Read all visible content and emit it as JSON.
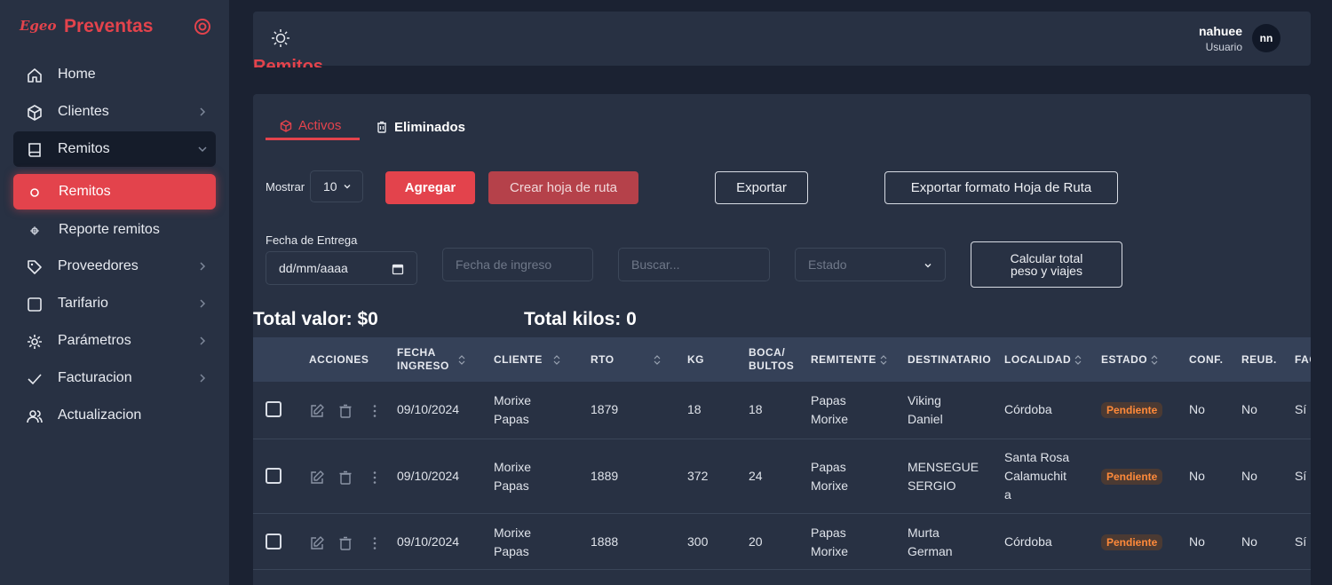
{
  "sidebar": {
    "logo": "Egeo",
    "title": "Preventas",
    "items": [
      {
        "label": "Home",
        "icon": "home-icon"
      },
      {
        "label": "Clientes",
        "icon": "box-icon"
      },
      {
        "label": "Remitos",
        "icon": "book-icon"
      },
      {
        "label": "Remitos",
        "icon": "circle-icon"
      },
      {
        "label": "Reporte remitos",
        "icon": "dot-icon"
      },
      {
        "label": "Proveedores",
        "icon": "tag-icon"
      },
      {
        "label": "Tarifario",
        "icon": "square-icon"
      },
      {
        "label": "Parámetros",
        "icon": "gear-icon"
      },
      {
        "label": "Facturacion",
        "icon": "check-icon"
      },
      {
        "label": "Actualizacion",
        "icon": "users-icon"
      }
    ]
  },
  "header": {
    "user_name": "nahuee",
    "user_role": "Usuario",
    "avatar_initials": "nn"
  },
  "page": {
    "title": "Remitos"
  },
  "tabs": [
    {
      "label": "Activos",
      "active": true
    },
    {
      "label": "Eliminados",
      "active": false
    }
  ],
  "toolbar": {
    "mostrar_label": "Mostrar",
    "page_size": "10",
    "agregar": "Agregar",
    "crear_hoja": "Crear hoja de ruta",
    "exportar": "Exportar",
    "exportar_formato": "Exportar formato Hoja de Ruta"
  },
  "filters": {
    "fecha_entrega_label": "Fecha de Entrega",
    "fecha_entrega_value": "dd/mm/aaaa",
    "fecha_ingreso_placeholder": "Fecha de ingreso",
    "buscar_placeholder": "Buscar...",
    "estado_placeholder": "Estado",
    "calcular_line1": "Calcular total",
    "calcular_line2": "peso y viajes"
  },
  "totals": {
    "valor": "Total valor: $0",
    "kilos": "Total kilos: 0"
  },
  "table": {
    "headers": {
      "acciones": "ACCIONES",
      "fecha1": "FECHA",
      "fecha2": "INGRESO",
      "cliente": "CLIENTE",
      "rto": "RTO",
      "kg": "KG",
      "boca1": "BOCA/",
      "boca2": "BULTOS",
      "remitente": "REMITENTE",
      "destinatario": "DESTINATARIO",
      "localidad": "LOCALIDAD",
      "estado": "ESTADO",
      "conf": "CONF.",
      "reub": "REUB.",
      "fac": "FACTURA"
    },
    "rows": [
      {
        "fecha": "09/10/2024",
        "cliente1": "Morixe",
        "cliente2": "Papas",
        "rto": "1879",
        "kg": "18",
        "bultos": "18",
        "rem1": "Papas",
        "rem2": "Morixe",
        "dest1": "Viking",
        "dest2": "Daniel",
        "loc1": "Córdoba",
        "loc2": "",
        "loc3": "",
        "estado": "Pendiente",
        "conf": "No",
        "reub": "No",
        "fac": "Sí"
      },
      {
        "fecha": "09/10/2024",
        "cliente1": "Morixe",
        "cliente2": "Papas",
        "rto": "1889",
        "kg": "372",
        "bultos": "24",
        "rem1": "Papas",
        "rem2": "Morixe",
        "dest1": "MENSEGUE",
        "dest2": "SERGIO",
        "loc1": "Santa Rosa",
        "loc2": "Calamuchit",
        "loc3": "a",
        "estado": "Pendiente",
        "conf": "No",
        "reub": "No",
        "fac": "Sí"
      },
      {
        "fecha": "09/10/2024",
        "cliente1": "Morixe",
        "cliente2": "Papas",
        "rto": "1888",
        "kg": "300",
        "bultos": "20",
        "rem1": "Papas",
        "rem2": "Morixe",
        "dest1": "Murta",
        "dest2": "German",
        "loc1": "Córdoba",
        "loc2": "",
        "loc3": "",
        "estado": "Pendiente",
        "conf": "No",
        "reub": "No",
        "fac": "Sí"
      }
    ]
  },
  "colors": {
    "accent": "#e3434c",
    "sidebar_bg": "#283143",
    "page_bg": "#1b2232",
    "badge_text": "#ff8a3a"
  }
}
